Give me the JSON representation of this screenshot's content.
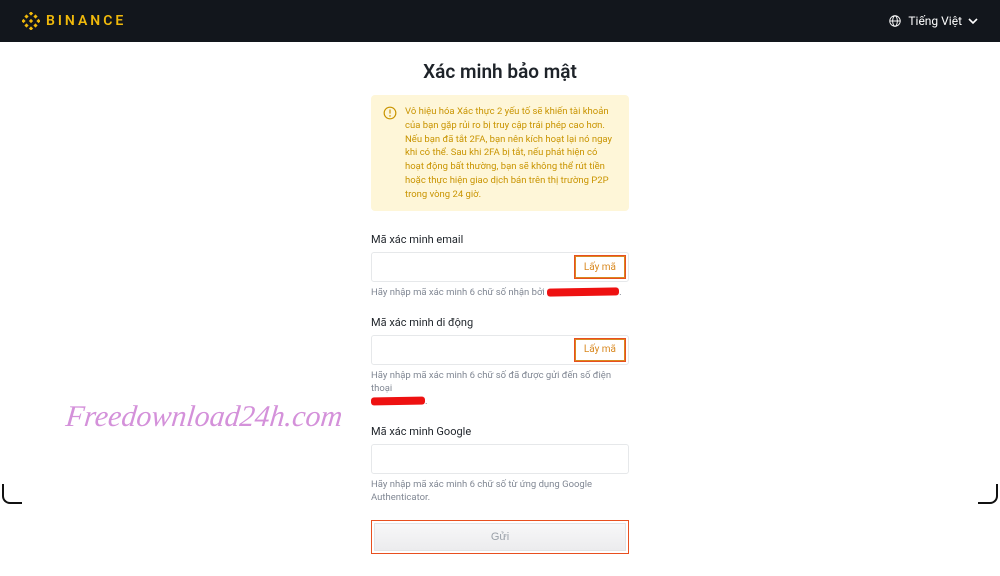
{
  "header": {
    "brand": "BINANCE",
    "language": "Tiếng Việt"
  },
  "card": {
    "title": "Xác minh bảo mật",
    "warning": "Vô hiệu hóa Xác thực 2 yếu tố sẽ khiến tài khoản của bạn gặp rủi ro bị truy cập trái phép cao hơn. Nếu bạn đã tắt 2FA, bạn nên kích hoạt lại nó ngay khi có thể. Sau khi 2FA bị tắt, nếu phát hiện có hoạt động bất thường, bạn sẽ không thể rút tiền hoặc thực hiện giao dịch bán trên thị trường P2P trong vòng 24 giờ.",
    "fields": {
      "email": {
        "label": "Mã xác minh email",
        "button": "Lấy mã",
        "hint_prefix": "Hãy nhập mã xác minh 6 chữ số nhận bởi "
      },
      "mobile": {
        "label": "Mã xác minh di động",
        "button": "Lấy mã",
        "hint": "Hãy nhập mã xác minh 6 chữ số đã được gửi đến số điện thoại"
      },
      "google": {
        "label": "Mã xác minh Google",
        "hint": "Hãy nhập mã xác minh 6 chữ số từ ứng dụng Google Authenticator."
      }
    },
    "submit": "Gửi"
  },
  "watermark": "Freedownload24h.com"
}
